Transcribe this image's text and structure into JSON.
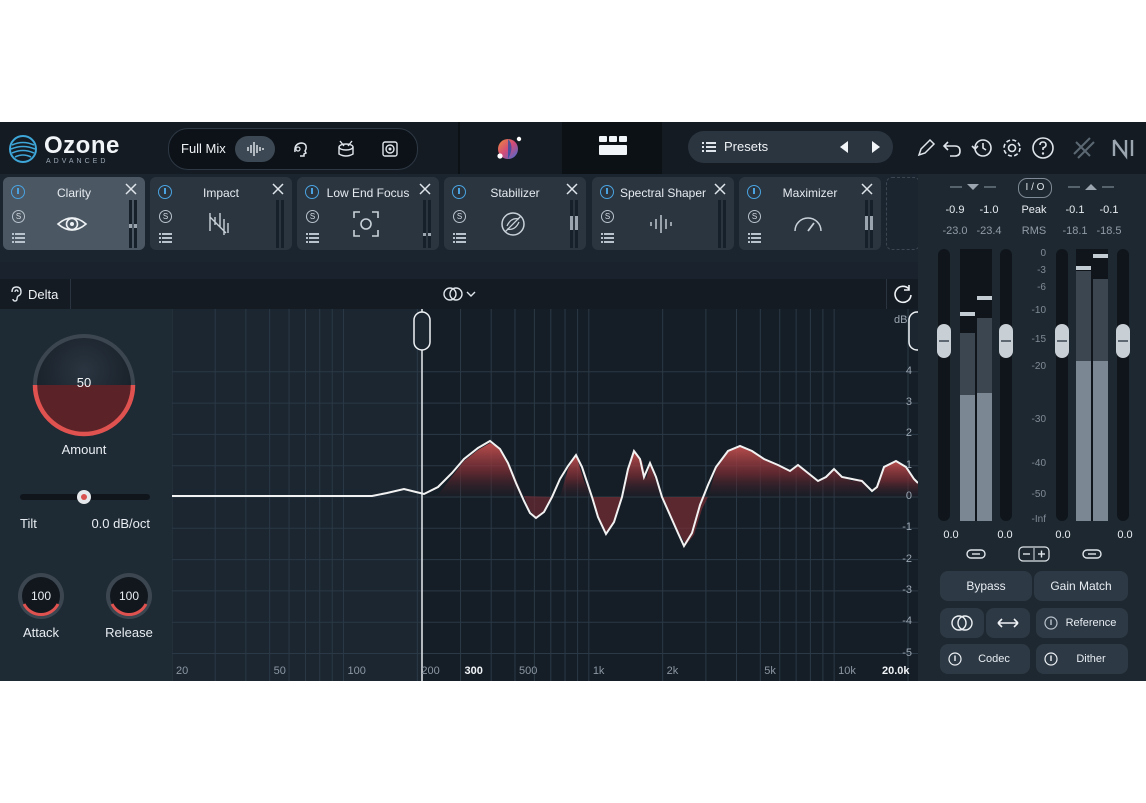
{
  "app": {
    "logo_name": "Ozone",
    "logo_sub": "ADVANCED",
    "mode_label": "Full Mix",
    "presets_label": "Presets"
  },
  "modules": [
    {
      "name": "Clarity",
      "icon": "eye-icon",
      "active": true
    },
    {
      "name": "Impact",
      "icon": "impact-icon",
      "active": false
    },
    {
      "name": "Low End Focus",
      "icon": "focus-icon",
      "active": false
    },
    {
      "name": "Stabilizer",
      "icon": "stabilizer-icon",
      "active": false
    },
    {
      "name": "Spectral Shaper",
      "icon": "spectral-icon",
      "active": false
    },
    {
      "name": "Maximizer",
      "icon": "gauge-icon",
      "active": false
    }
  ],
  "module_solo_label": "S",
  "subheader": {
    "delta_label": "Delta"
  },
  "clarity": {
    "amount_value": "50",
    "amount_label": "Amount",
    "amount_fraction": 0.5,
    "tilt_label": "Tilt",
    "tilt_value": "0.0 dB/oct",
    "attack_value": "100",
    "attack_label": "Attack",
    "release_value": "100",
    "release_label": "Release"
  },
  "graph": {
    "db_unit": "dB",
    "db_ticks": [
      "4",
      "3",
      "2",
      "1",
      "0",
      "-1",
      "-2",
      "-3",
      "-4",
      "-5"
    ],
    "freq_ticks": [
      "20",
      "50",
      "100",
      "200",
      "300",
      "500",
      "1k",
      "2k",
      "5k",
      "10k",
      "20.0k"
    ],
    "colors": {
      "fill": "#b64a4c",
      "line": "#f2f2f2",
      "grid": "#2b3946"
    }
  },
  "meters": {
    "input_peak_l": "-0.9",
    "input_peak_r": "-1.0",
    "input_rms_l": "-23.0",
    "input_rms_r": "-23.4",
    "peak_label": "Peak",
    "rms_label": "RMS",
    "io_label": "I / O",
    "output_peak_l": "-0.1",
    "output_peak_r": "-0.1",
    "output_rms_l": "-18.1",
    "output_rms_r": "-18.5",
    "scale": [
      "0",
      "-3",
      "-6",
      "-10",
      "-15",
      "-20",
      "-30",
      "-40",
      "-50",
      "-Inf"
    ],
    "input_gain_l": "0.0",
    "input_gain_r": "0.0",
    "output_gain_l": "0.0",
    "output_gain_r": "0.0"
  },
  "buttons": {
    "bypass": "Bypass",
    "gain_match": "Gain Match",
    "reference": "Reference",
    "codec": "Codec",
    "dither": "Dither"
  }
}
